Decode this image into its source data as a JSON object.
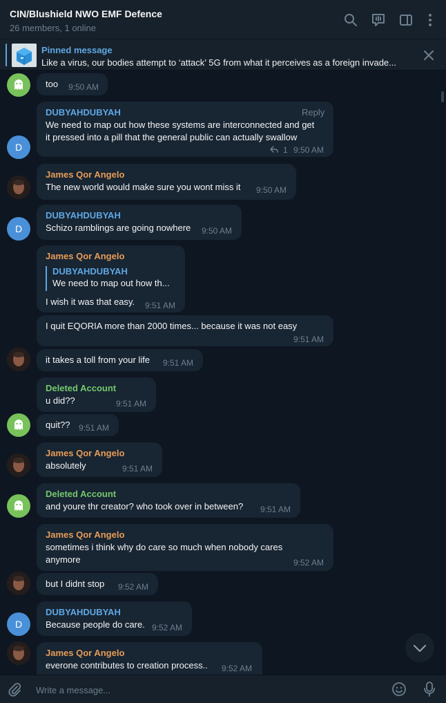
{
  "header": {
    "title": "CIN/Blushield NWO EMF Defence",
    "subtitle": "26 members, 1 online",
    "icons": [
      "search-icon",
      "voice-chat-icon",
      "sidebar-toggle-icon",
      "more-icon"
    ]
  },
  "pinned": {
    "title": "Pinned message",
    "text": "Like a virus, our bodies attempt to ‘attack’ 5G from what it perceives as a foreign invade..."
  },
  "messages": [
    {
      "text": "too",
      "time": "9:50 AM"
    },
    {
      "sender": "DUBYAHDUBYAH",
      "reply_label": "Reply",
      "line1": "We need to map out how these systems are interconnected and get",
      "line2": "it pressed into a pill that the general public can actually swallow",
      "reply_count": "1",
      "time": "9:50 AM"
    },
    {
      "sender": "James Qor Angelo",
      "text": "The new world would make sure you wont miss it",
      "time": "9:50 AM"
    },
    {
      "sender": "DUBYAHDUBYAH",
      "text": "Schizo ramblings are going nowhere",
      "time": "9:50 AM"
    },
    {
      "sender": "James Qor Angelo",
      "quote_sender": "DUBYAHDUBYAH",
      "quote_text": "We need to map out how th...",
      "text": "I wish it was that easy.",
      "time": "9:51 AM"
    },
    {
      "text": "I quit EQORIA more than 2000 times... because it was not easy",
      "time": "9:51 AM"
    },
    {
      "text": "it takes a toll from your life",
      "time": "9:51 AM"
    },
    {
      "sender": "Deleted Account",
      "text": "u did??",
      "time": "9:51 AM"
    },
    {
      "text": "quit??",
      "time": "9:51 AM"
    },
    {
      "sender": "James Qor Angelo",
      "text": "absolutely",
      "time": "9:51 AM"
    },
    {
      "sender": "Deleted Account",
      "text": "and youre thr creator? who took over in between?",
      "time": "9:51 AM"
    },
    {
      "sender": "James Qor Angelo",
      "line1": "sometimes i think why do care so much when nobody cares",
      "line2": "anymore",
      "time": "9:52 AM"
    },
    {
      "text": "but I didnt stop",
      "time": "9:52 AM"
    },
    {
      "sender": "DUBYAHDUBYAH",
      "text": "Because people do care.",
      "time": "9:52 AM"
    },
    {
      "sender": "James Qor Angelo",
      "text": "everone contributes to creation process..",
      "time": "9:52 AM"
    }
  ],
  "avatars": {
    "d_letter": "D"
  },
  "composer": {
    "placeholder": "Write a message...",
    "icons": [
      "attach-icon",
      "emoji-icon",
      "microphone-icon"
    ]
  },
  "colors": {
    "background": "#0e1621",
    "panel": "#17212b",
    "bubble": "#182533",
    "accent_blue": "#5fa8e4",
    "name_orange": "#e79c56",
    "name_green": "#74c86b",
    "muted": "#6d7f8f"
  }
}
